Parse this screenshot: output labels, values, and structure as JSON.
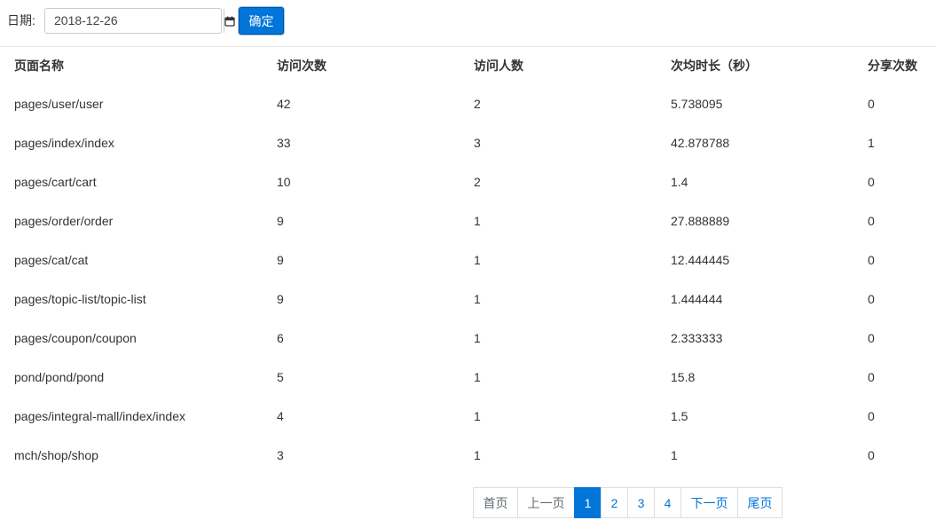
{
  "filter": {
    "date_label": "日期:",
    "date_value": "2018-12-26",
    "confirm_label": "确定",
    "calendar_icon": "calendar-icon"
  },
  "table": {
    "headers": [
      "页面名称",
      "访问次数",
      "访问人数",
      "次均时长（秒）",
      "分享次数"
    ],
    "rows": [
      [
        "pages/user/user",
        "42",
        "2",
        "5.738095",
        "0"
      ],
      [
        "pages/index/index",
        "33",
        "3",
        "42.878788",
        "1"
      ],
      [
        "pages/cart/cart",
        "10",
        "2",
        "1.4",
        "0"
      ],
      [
        "pages/order/order",
        "9",
        "1",
        "27.888889",
        "0"
      ],
      [
        "pages/cat/cat",
        "9",
        "1",
        "12.444445",
        "0"
      ],
      [
        "pages/topic-list/topic-list",
        "9",
        "1",
        "1.444444",
        "0"
      ],
      [
        "pages/coupon/coupon",
        "6",
        "1",
        "2.333333",
        "0"
      ],
      [
        "pond/pond/pond",
        "5",
        "1",
        "15.8",
        "0"
      ],
      [
        "pages/integral-mall/index/index",
        "4",
        "1",
        "1.5",
        "0"
      ],
      [
        "mch/shop/shop",
        "3",
        "1",
        "1",
        "0"
      ]
    ]
  },
  "pagination": {
    "first": "首页",
    "prev": "上一页",
    "pages": [
      "1",
      "2",
      "3",
      "4"
    ],
    "current": "1",
    "next": "下一页",
    "last": "尾页"
  },
  "colors": {
    "primary": "#0275d8",
    "text": "#333333",
    "border": "#dddddd"
  }
}
